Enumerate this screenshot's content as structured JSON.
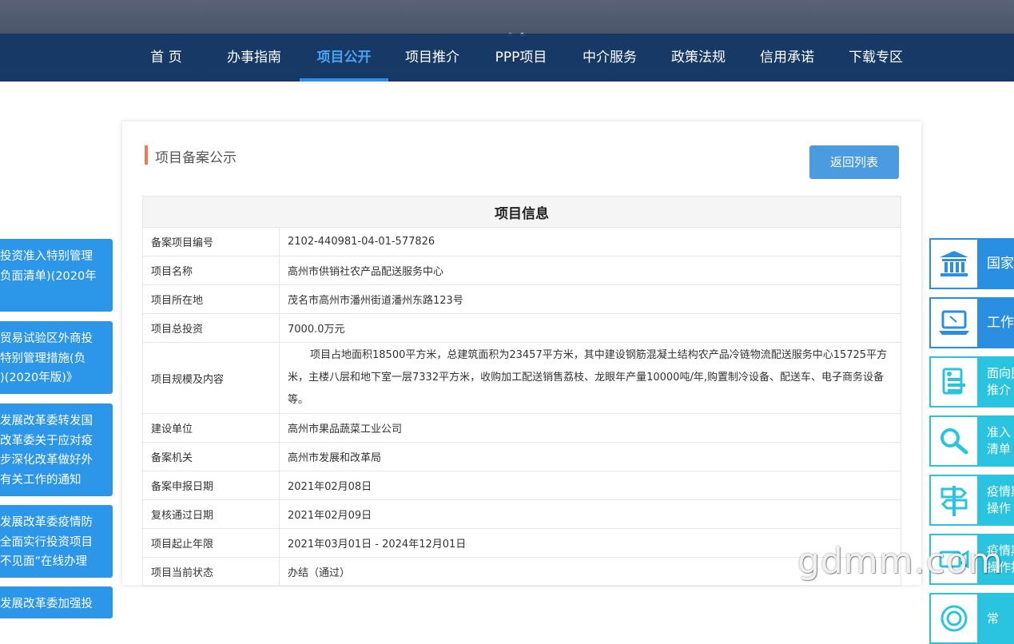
{
  "nav": {
    "items": [
      {
        "label": "首 页"
      },
      {
        "label": "办事指南"
      },
      {
        "label": "项目公开"
      },
      {
        "label": "项目推介"
      },
      {
        "label": "PPP项目"
      },
      {
        "label": "中介服务"
      },
      {
        "label": "政策法规"
      },
      {
        "label": "信用承诺"
      },
      {
        "label": "下载专区"
      }
    ],
    "active_index": 2
  },
  "card": {
    "title": "项目备案公示",
    "back_button": "返回列表",
    "table_header": "项目信息",
    "rows": [
      {
        "label": "备案项目编号",
        "value": "2102-440981-04-01-577826"
      },
      {
        "label": "项目名称",
        "value": "高州市供销社农产品配送服务中心"
      },
      {
        "label": "项目所在地",
        "value": "茂名市高州市潘州街道潘州东路123号"
      },
      {
        "label": "项目总投资",
        "value": "7000.0万元"
      },
      {
        "label": "项目规模及内容",
        "value": "项目占地面积18500平方米，总建筑面积为23457平方米，其中建设钢筋混凝土结构农产品冷链物流配送服务中心15725平方米，主楼八层和地下室一层7332平方米，收购加工配送销售荔枝、龙眼年产量10000吨/年,购置制冷设备、配送车、电子商务设备等。"
      },
      {
        "label": "建设单位",
        "value": "高州市果品蔬菜工业公司"
      },
      {
        "label": "备案机关",
        "value": "高州市发展和改革局"
      },
      {
        "label": "备案申报日期",
        "value": "2021年02月08日"
      },
      {
        "label": "复核通过日期",
        "value": "2021年02月09日"
      },
      {
        "label": "项目起止年限",
        "value": "2021年03月01日 - 2024年12月01日"
      },
      {
        "label": "项目当前状态",
        "value": "办结（通过）"
      }
    ]
  },
  "left_panels": [
    {
      "lines": [
        "投资准入特别管理",
        "负面清单)(2020年"
      ]
    },
    {
      "lines": [
        "贸易试验区外商投",
        "特别管理措施(负",
        ")(2020年版)》"
      ]
    },
    {
      "lines": [
        "发展改革委转发国",
        "改革委关于应对疫",
        "步深化改革做好外",
        "有关工作的通知"
      ]
    },
    {
      "lines": [
        "发展改革委疫情防",
        "全面实行投资项目",
        "不见面”在线办理"
      ]
    },
    {
      "lines": [
        "发展改革委加强投"
      ]
    }
  ],
  "right_cards": [
    {
      "icon": "bank-icon",
      "lines": [
        "国家"
      ]
    },
    {
      "icon": "laptop-icon",
      "lines": [
        "工作"
      ]
    },
    {
      "icon": "doc-icon",
      "lines": [
        "面向民",
        "推介"
      ]
    },
    {
      "icon": "search-icon",
      "lines": [
        "准入",
        "清单"
      ]
    },
    {
      "icon": "signpost-icon",
      "lines": [
        "疫情期",
        "操作"
      ]
    },
    {
      "icon": "camera-icon",
      "lines": [
        "疫情期",
        "操作指"
      ]
    },
    {
      "icon": "target-icon",
      "lines": [
        "常"
      ]
    }
  ],
  "watermark": "gdmm.com"
}
